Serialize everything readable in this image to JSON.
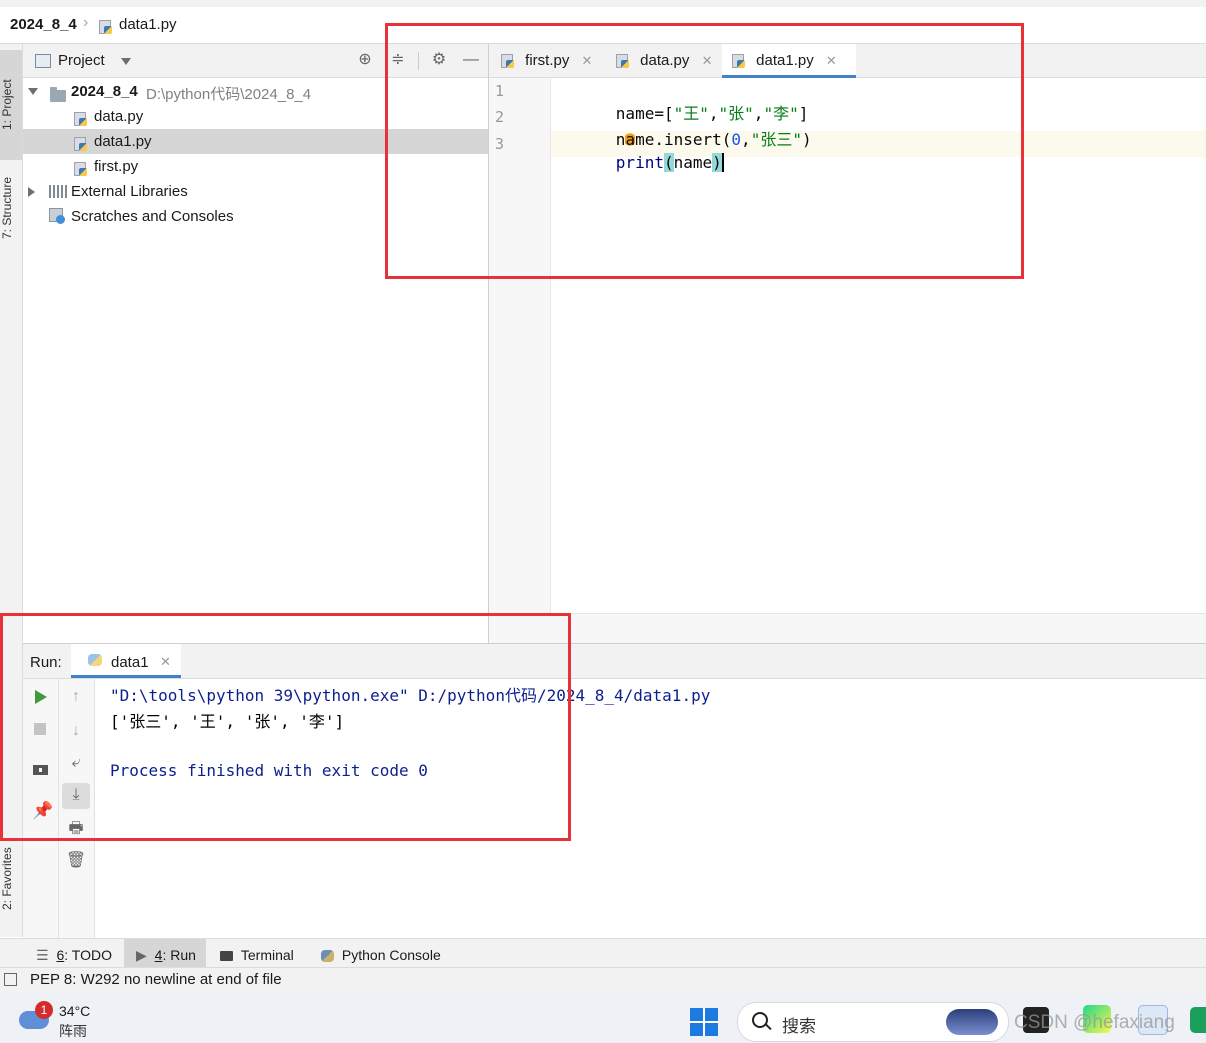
{
  "breadcrumb": {
    "project": "2024_8_4",
    "file": "data1.py"
  },
  "project_panel": {
    "title": "Project",
    "root_name": "2024_8_4",
    "root_path": "D:\\python代码\\2024_8_4",
    "files": [
      "data.py",
      "data1.py",
      "first.py"
    ],
    "external_libraries": "External Libraries",
    "scratches": "Scratches and Consoles"
  },
  "left_tabs": {
    "project": "1: Project",
    "structure": "7: Structure",
    "favorites": "2: Favorites"
  },
  "editor": {
    "tabs": [
      "first.py",
      "data.py",
      "data1.py"
    ],
    "active_tab": "data1.py",
    "line_numbers": [
      "1",
      "2",
      "3"
    ],
    "code": {
      "line1": {
        "a": "name=[",
        "s1": "\"王\"",
        "c1": ",",
        "s2": "\"张\"",
        "c2": ",",
        "s3": "\"李\"",
        "end": "]"
      },
      "line2": {
        "a": "n",
        "b": "a",
        "c": "me.insert(",
        "num": "0",
        "comma": ",",
        "str": "\"张三\"",
        "end": ")"
      },
      "line3": {
        "fn": "print",
        "open": "(",
        "arg": "name",
        "close": ")"
      }
    }
  },
  "run_panel": {
    "label": "Run:",
    "tab": "data1",
    "output": [
      "\"D:\\tools\\python 39\\python.exe\" D:/python代码/2024_8_4/data1.py",
      "['张三', '王', '张', '李']",
      "",
      "Process finished with exit code 0"
    ]
  },
  "bottom_tabs": {
    "todo_num": "6",
    "todo": ": TODO",
    "run_num": "4",
    "run": ": Run",
    "terminal": "Terminal",
    "python_console": "Python Console"
  },
  "status_bar": {
    "message": "PEP 8: W292 no newline at end of file"
  },
  "taskbar": {
    "weather_temp": "34°C",
    "weather_desc": "阵雨",
    "weather_badge": "1",
    "search_placeholder": "搜索",
    "watermark": "CSDN @hefaxiang"
  },
  "colors": {
    "accent": "#4083c9",
    "highlight_box": "#e8323a",
    "output_text": "#0b1f8f",
    "string": "#067d17"
  }
}
